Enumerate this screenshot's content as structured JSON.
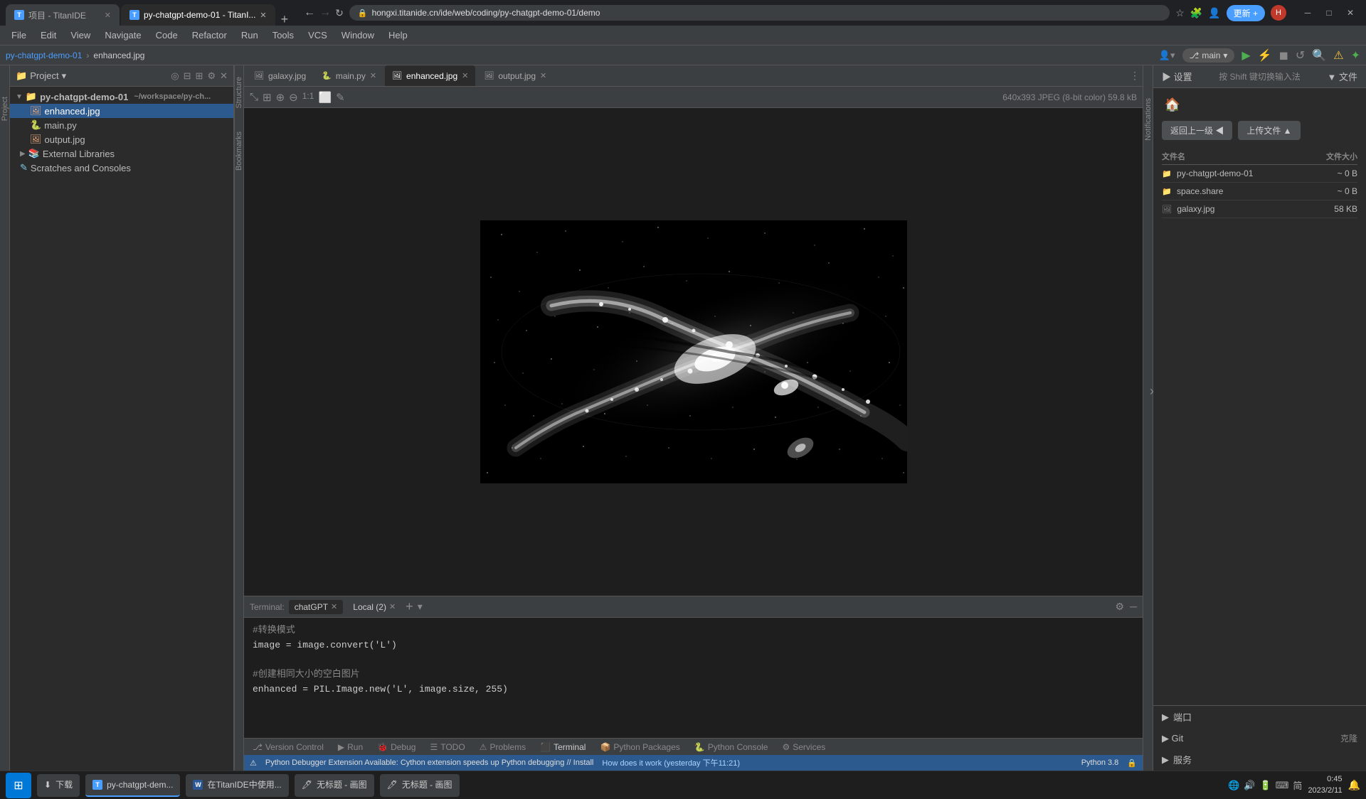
{
  "browser": {
    "tabs": [
      {
        "label": "项目 - TitanIDE",
        "active": false,
        "favicon": "T"
      },
      {
        "label": "py-chatgpt-demo-01 - TitanI...",
        "active": true,
        "favicon": "T"
      }
    ],
    "address": "hongxi.titanide.cn/ide/web/coding/py-chatgpt-demo-01/demo",
    "update_btn": "更新 +"
  },
  "menu": {
    "items": [
      "File",
      "Edit",
      "View",
      "Navigate",
      "Code",
      "Refactor",
      "Run",
      "Tools",
      "VCS",
      "Window",
      "Help"
    ]
  },
  "breadcrumb": {
    "project": "py-chatgpt-demo-01",
    "file": "enhanced.jpg"
  },
  "editor": {
    "tabs": [
      {
        "label": "galaxy.jpg",
        "active": false,
        "icon": "🖼"
      },
      {
        "label": "main.py",
        "active": false,
        "icon": "🐍"
      },
      {
        "label": "enhanced.jpg",
        "active": true,
        "icon": "🖼"
      },
      {
        "label": "output.jpg",
        "active": false,
        "icon": "🖼"
      }
    ],
    "image_info": "640x393 JPEG (8-bit color) 59.8 kB"
  },
  "project_tree": {
    "title": "Project",
    "root": "py-chatgpt-demo-01",
    "root_path": "~/workspace/py-ch...",
    "items": [
      {
        "label": "enhanced.jpg",
        "type": "image",
        "selected": true,
        "indent": 2
      },
      {
        "label": "main.py",
        "type": "python",
        "selected": false,
        "indent": 2
      },
      {
        "label": "output.jpg",
        "type": "image",
        "selected": false,
        "indent": 2
      },
      {
        "label": "External Libraries",
        "type": "folder",
        "selected": false,
        "indent": 1
      },
      {
        "label": "Scratches and Consoles",
        "type": "scratch",
        "selected": false,
        "indent": 1
      }
    ]
  },
  "right_sidebar": {
    "settings_label": "设置",
    "file_label": "文件",
    "keyboard_hint": "按 Shift 键切换输入法",
    "back_btn": "返回上一级 ◀",
    "upload_btn": "上传文件 ▲",
    "col_name": "文件名",
    "col_size": "文件大小",
    "files": [
      {
        "name": "py-chatgpt-demo-01",
        "size": "~ 0 B",
        "type": "folder"
      },
      {
        "name": "space.share",
        "size": "~ 0 B",
        "type": "folder"
      },
      {
        "name": "galaxy.jpg",
        "size": "58 KB",
        "type": "image"
      }
    ],
    "sections": [
      {
        "label": "端口",
        "expanded": false
      },
      {
        "label": "Git",
        "expanded": false,
        "right": "克隆"
      },
      {
        "label": "服务",
        "expanded": false
      }
    ]
  },
  "terminal": {
    "label": "Terminal:",
    "tabs": [
      {
        "label": "chatGPT",
        "active": true
      },
      {
        "label": "Local (2)",
        "active": false
      }
    ],
    "content": [
      {
        "type": "comment",
        "text": "#转换模式"
      },
      {
        "type": "code",
        "text": "image = image.convert('L')"
      },
      {
        "type": "blank",
        "text": ""
      },
      {
        "type": "comment",
        "text": "#创建相同大小的空白图片"
      },
      {
        "type": "code",
        "text": "enhanced = PIL.Image.new('L', image.size, 255)"
      }
    ]
  },
  "bottom_toolbar": {
    "items": [
      {
        "label": "Version Control",
        "icon": "⎇"
      },
      {
        "label": "Run",
        "icon": "▶"
      },
      {
        "label": "Debug",
        "icon": "🐞"
      },
      {
        "label": "TODO",
        "icon": "☰"
      },
      {
        "label": "Problems",
        "icon": "⚠"
      },
      {
        "label": "Terminal",
        "icon": "⬛",
        "active": true
      },
      {
        "label": "Python Packages",
        "icon": "📦"
      },
      {
        "label": "Python Console",
        "icon": "🐍"
      },
      {
        "label": "Services",
        "icon": "⚙"
      }
    ]
  },
  "status_bar": {
    "warning": "Python Debugger Extension Available: Cython extension speeds up Python debugging // Install",
    "how": "How does it work (yesterday 下午11:21)",
    "python_version": "Python 3.8"
  },
  "taskbar": {
    "apps": [
      {
        "label": "下载",
        "icon": "⬇",
        "active": false
      },
      {
        "label": "py-chatgpt-dem...",
        "icon": "T",
        "active": true
      },
      {
        "label": "在TitanIDE中使用...",
        "icon": "W",
        "active": false
      },
      {
        "label": "无标题 - 画图",
        "icon": "🖊",
        "active": false
      },
      {
        "label": "无标题 - 画图",
        "icon": "🖊",
        "active": false
      }
    ],
    "time": "0:45",
    "date": "2023/2/11"
  }
}
